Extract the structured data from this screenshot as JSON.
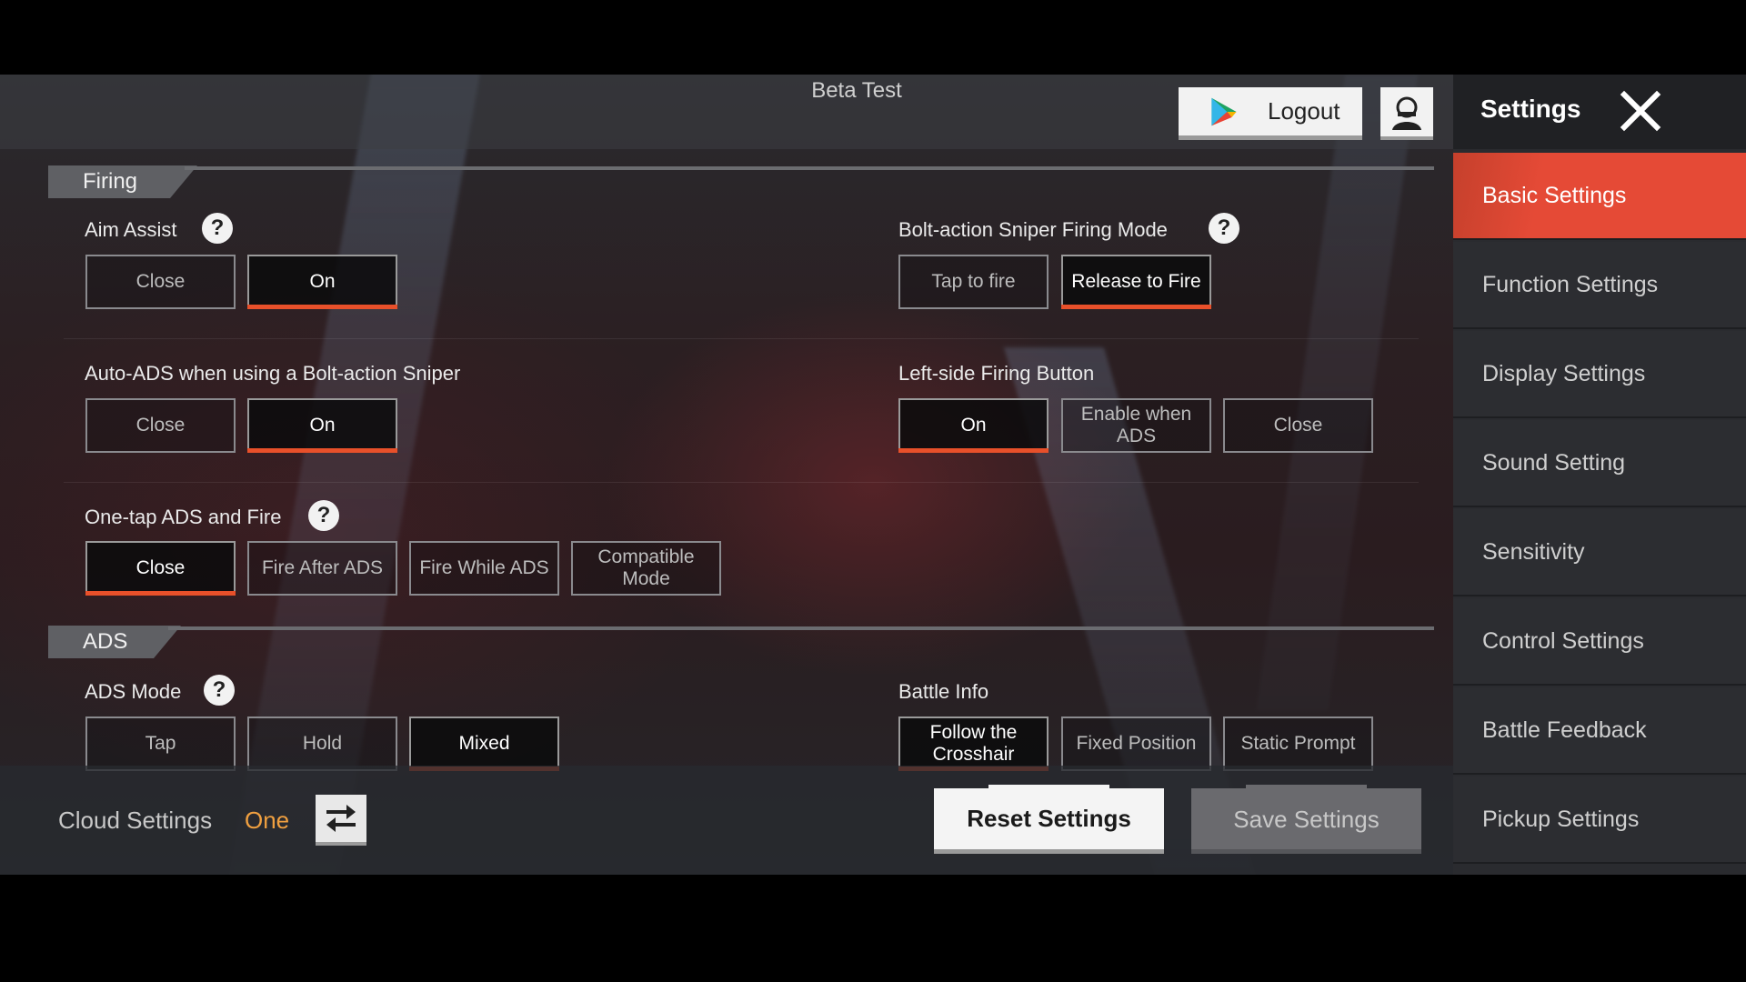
{
  "header": {
    "title": "Beta Test",
    "logout_label": "Logout",
    "play_icon": "play-store-icon",
    "avatar_icon": "user-avatar-icon"
  },
  "sidebar": {
    "title": "Settings",
    "close_icon": "close-icon",
    "items": [
      {
        "label": "Basic Settings",
        "active": true
      },
      {
        "label": "Function Settings",
        "active": false
      },
      {
        "label": "Display Settings",
        "active": false
      },
      {
        "label": "Sound Setting",
        "active": false
      },
      {
        "label": "Sensitivity",
        "active": false
      },
      {
        "label": "Control Settings",
        "active": false
      },
      {
        "label": "Battle Feedback",
        "active": false
      },
      {
        "label": "Pickup Settings",
        "active": false
      }
    ]
  },
  "sections": {
    "firing": {
      "title": "Firing",
      "aim_assist": {
        "label": "Aim Assist",
        "options": [
          "Close",
          "On"
        ],
        "selected": "On"
      },
      "bolt_sniper_mode": {
        "label": "Bolt-action Sniper Firing Mode",
        "options": [
          "Tap to fire",
          "Release to Fire"
        ],
        "selected": "Release to Fire"
      },
      "auto_ads": {
        "label": "Auto-ADS when using a Bolt-action Sniper",
        "options": [
          "Close",
          "On"
        ],
        "selected": "On"
      },
      "left_fire": {
        "label": "Left-side Firing Button",
        "options": [
          "On",
          "Enable when ADS",
          "Close"
        ],
        "selected": "On"
      },
      "one_tap": {
        "label": "One-tap ADS and Fire",
        "options": [
          "Close",
          "Fire After ADS",
          "Fire While ADS",
          "Compatible Mode"
        ],
        "selected": "Close"
      }
    },
    "ads": {
      "title": "ADS",
      "ads_mode": {
        "label": "ADS Mode",
        "options": [
          "Tap",
          "Hold",
          "Mixed"
        ],
        "selected": "Mixed"
      },
      "battle_info": {
        "label": "Battle Info",
        "options": [
          "Follow the Crosshair",
          "Fixed Position",
          "Static Prompt"
        ],
        "selected": "Follow the Crosshair"
      }
    }
  },
  "footer": {
    "cloud_label": "Cloud Settings",
    "cloud_value": "One",
    "swap_icon": "swap-arrows-icon",
    "reset_label": "Reset Settings",
    "save_label": "Save Settings"
  },
  "colors": {
    "accent": "#e8502a",
    "active_tab": "#e54a36",
    "cloud_value": "#f0a040"
  }
}
